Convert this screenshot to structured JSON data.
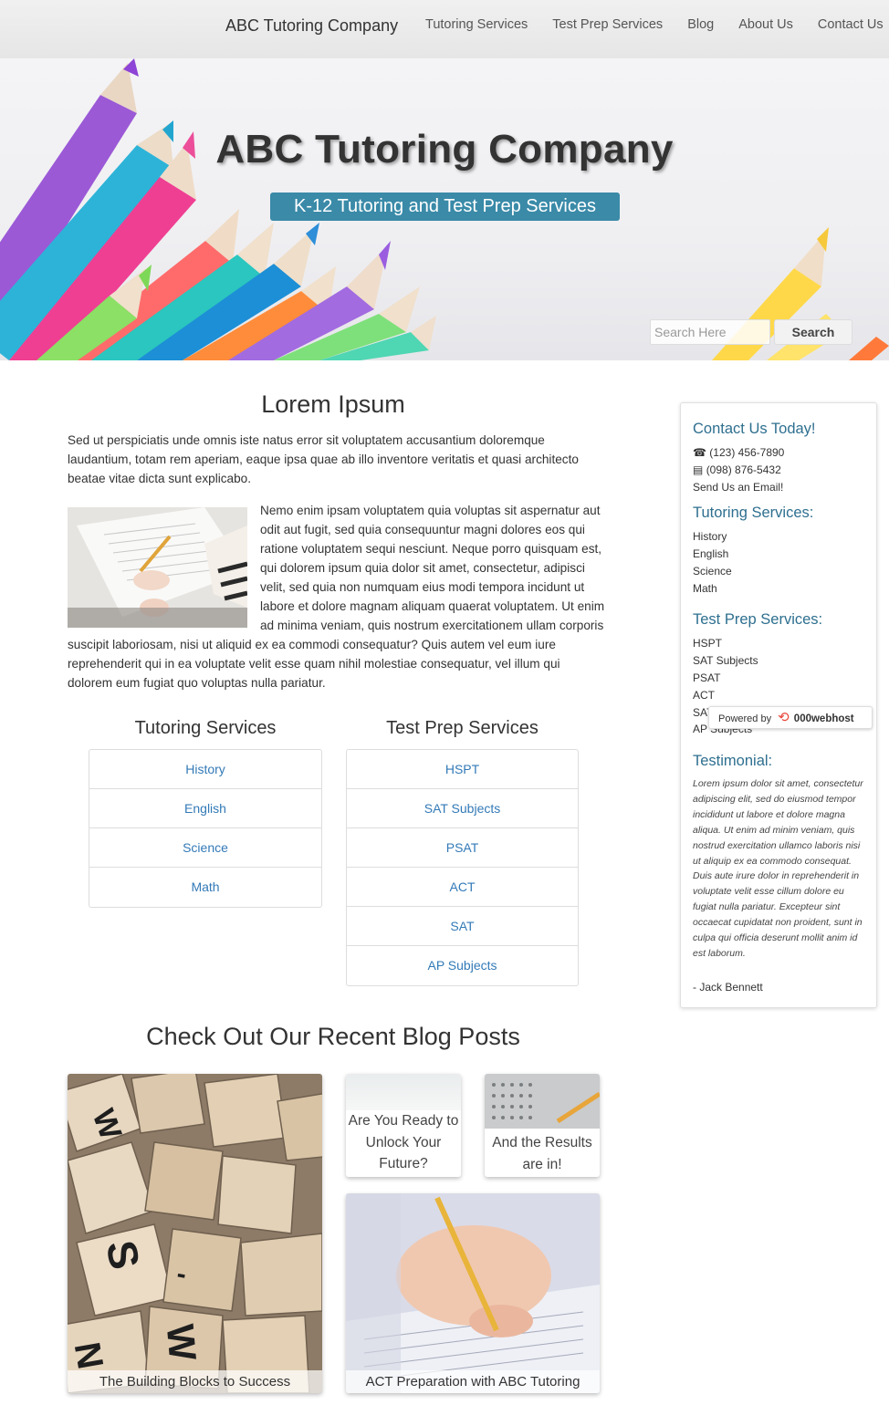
{
  "nav": {
    "brand": "ABC Tutoring Company",
    "links": [
      "Tutoring Services",
      "Test Prep Services",
      "Blog",
      "About Us",
      "Contact Us"
    ]
  },
  "hero": {
    "title": "ABC Tutoring Company",
    "subtitle": "K-12 Tutoring and Test Prep Services",
    "search_placeholder": "Search Here",
    "search_button": "Search"
  },
  "main": {
    "title": "Lorem Ipsum",
    "paragraph1": "Sed ut perspiciatis unde omnis iste natus error sit voluptatem accusantium doloremque laudantium, totam rem aperiam, eaque ipsa quae ab illo inventore veritatis et quasi architecto beatae vitae dicta sunt explicabo.",
    "paragraph2": "Nemo enim ipsam voluptatem quia voluptas sit aspernatur aut odit aut fugit, sed quia consequuntur magni dolores eos qui ratione voluptatem sequi nesciunt. Neque porro quisquam est, qui dolorem ipsum quia dolor sit amet, consectetur, adipisci velit, sed quia non numquam eius modi tempora incidunt ut labore et dolore magnam aliquam quaerat voluptatem. Ut enim ad minima veniam, quis nostrum exercitationem ullam corporis suscipit laboriosam, nisi ut aliquid ex ea commodi consequatur? Quis autem vel eum iure reprehenderit qui in ea voluptate velit esse quam nihil molestiae consequatur, vel illum qui dolorem eum fugiat quo voluptas nulla pariatur."
  },
  "tutoring": {
    "title": "Tutoring Services",
    "items": [
      "History",
      "English",
      "Science",
      "Math"
    ]
  },
  "testprep": {
    "title": "Test Prep Services",
    "items": [
      "HSPT",
      "SAT Subjects",
      "PSAT",
      "ACT",
      "SAT",
      "AP Subjects"
    ]
  },
  "blog": {
    "title": "Check Out Our Recent Blog Posts",
    "posts": [
      {
        "title": "The Building Blocks to Success"
      },
      {
        "title": "Are You Ready to Unlock Your Future?"
      },
      {
        "title": "And the Results are in!"
      },
      {
        "title": "ACT Preparation with ABC Tutoring"
      }
    ]
  },
  "sidebar": {
    "contact_title": "Contact Us Today!",
    "phone": "(123) 456-7890",
    "fax": "(098) 876-5432",
    "email_link": "Send Us an Email!",
    "tutoring_title": "Tutoring Services:",
    "tutoring_items": [
      "History",
      "English",
      "Science",
      "Math"
    ],
    "testprep_title": "Test Prep Services:",
    "testprep_items": [
      "HSPT",
      "SAT Subjects",
      "PSAT",
      "ACT",
      "SAT",
      "AP Subjects"
    ],
    "testimonial_title": "Testimonial:",
    "testimonial_text": "Lorem ipsum dolor sit amet, consectetur adipiscing elit, sed do eiusmod tempor incididunt ut labore et dolore magna aliqua. Ut enim ad minim veniam, quis nostrud exercitation ullamco laboris nisi ut aliquip ex ea commodo consequat. Duis aute irure dolor in reprehenderit in voluptate velit esse cillum dolore eu fugiat nulla pariatur. Excepteur sint occaecat cupidatat non proident, sunt in culpa qui officia deserunt mollit anim id est laborum.",
    "testimonial_author": "- Jack Bennett"
  },
  "badge": {
    "prefix": "Powered by",
    "brand": "000webhost"
  },
  "colors": {
    "accent": "#3a8aa8",
    "link": "#337ab7",
    "sidebar_heading": "#2e6f8f"
  }
}
